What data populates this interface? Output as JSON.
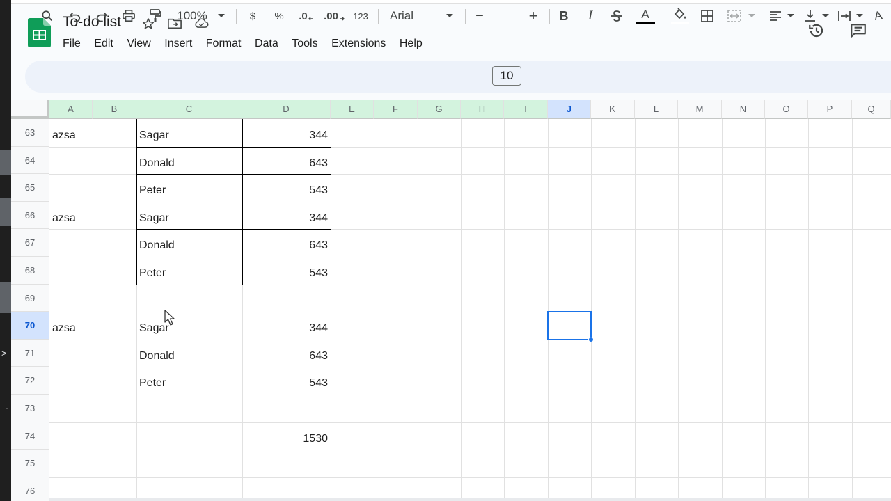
{
  "document": {
    "title": "To-do list"
  },
  "menu": [
    "File",
    "Edit",
    "View",
    "Insert",
    "Format",
    "Data",
    "Tools",
    "Extensions",
    "Help"
  ],
  "toolbar": {
    "zoom": "100%",
    "currency": "$",
    "percent": "%",
    "decrease_decimal": ".0",
    "increase_decimal": ".00",
    "number_format": "123",
    "font": "Arial",
    "font_size": "10",
    "minus": "−",
    "plus": "+",
    "bold": "B",
    "italic": "I",
    "text_color": "A",
    "rotate_text": "A"
  },
  "columns": [
    "A",
    "B",
    "C",
    "D",
    "E",
    "F",
    "G",
    "H",
    "I",
    "J",
    "K",
    "L",
    "M",
    "N",
    "O",
    "P",
    "Q"
  ],
  "rows": [
    {
      "num": "63",
      "a": "azsa",
      "c": "Sagar",
      "d": "344"
    },
    {
      "num": "64",
      "a": "",
      "c": "Donald",
      "d": "643"
    },
    {
      "num": "65",
      "a": "",
      "c": "Peter",
      "d": "543"
    },
    {
      "num": "66",
      "a": "azsa",
      "c": "Sagar",
      "d": "344"
    },
    {
      "num": "67",
      "a": "",
      "c": "Donald",
      "d": "643"
    },
    {
      "num": "68",
      "a": "",
      "c": "Peter",
      "d": "543"
    },
    {
      "num": "69",
      "a": "",
      "c": "",
      "d": ""
    },
    {
      "num": "70",
      "a": "azsa",
      "c": "Sagar",
      "d": "344"
    },
    {
      "num": "71",
      "a": "",
      "c": "Donald",
      "d": "643"
    },
    {
      "num": "72",
      "a": "",
      "c": "Peter",
      "d": "543"
    },
    {
      "num": "73",
      "a": "",
      "c": "",
      "d": ""
    },
    {
      "num": "74",
      "a": "",
      "c": "",
      "d": "1530"
    },
    {
      "num": "75",
      "a": "",
      "c": "",
      "d": ""
    },
    {
      "num": "76",
      "a": "",
      "c": "",
      "d": ""
    }
  ],
  "selection": {
    "column": "J",
    "row": "70"
  },
  "colors": {
    "accent": "#1a73e8",
    "sheets_green": "#0f9d58",
    "toolbar_bg": "#edf2fa"
  }
}
